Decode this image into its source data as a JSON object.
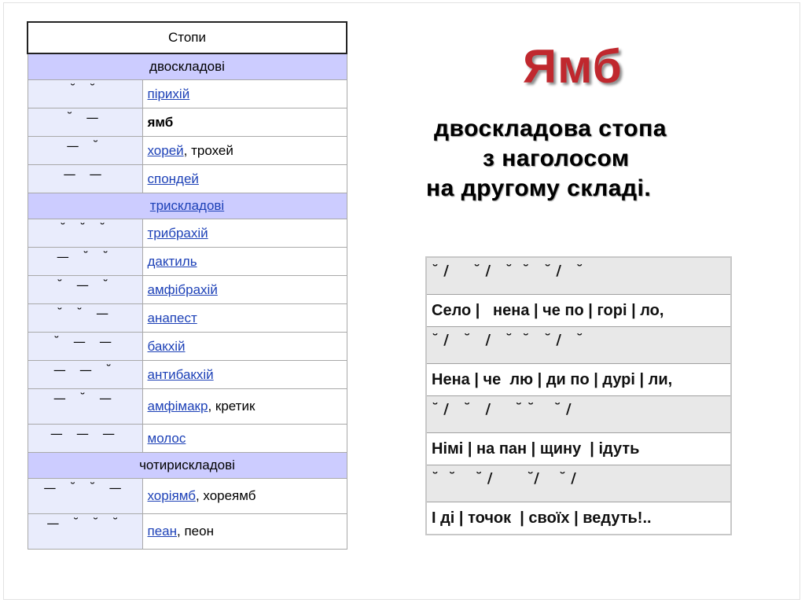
{
  "feet_table": {
    "header": "Стопи",
    "groups": {
      "two": "двоскладові",
      "three": "трискладові",
      "four": "чотирискладові"
    },
    "rows": [
      {
        "meter": "˘ ˘",
        "name": "пірихій",
        "suffix": ""
      },
      {
        "meter": "˘ —",
        "name": "ямб",
        "suffix": ""
      },
      {
        "meter": "— ˘",
        "name": "хорей",
        "suffix": ", трохей"
      },
      {
        "meter": "— —",
        "name": "спондей",
        "suffix": ""
      },
      {
        "meter": "˘ ˘ ˘",
        "name": "трибрахій",
        "suffix": ""
      },
      {
        "meter": "— ˘ ˘",
        "name": "дактиль",
        "suffix": ""
      },
      {
        "meter": "˘ — ˘",
        "name": "амфібрахій",
        "suffix": ""
      },
      {
        "meter": "˘ ˘ —",
        "name": "анапест",
        "suffix": ""
      },
      {
        "meter": "˘ — —",
        "name": "бакхій",
        "suffix": ""
      },
      {
        "meter": "— — ˘",
        "name": "антибакхій",
        "suffix": ""
      },
      {
        "meter": "— ˘ —",
        "name": "амфімакр",
        "suffix": ", кретик"
      },
      {
        "meter": "— — —",
        "name": "молос",
        "suffix": ""
      },
      {
        "meter": "— ˘ ˘ —",
        "name": "хоріямб",
        "suffix": ", хореямб"
      },
      {
        "meter": "— ˘ ˘ ˘",
        "name": "пеан",
        "suffix": ", пеон"
      }
    ]
  },
  "title": "Ямб",
  "definition": {
    "line1": "двоскладова стопа",
    "line2": "з наголосом",
    "line3": "на другому складі."
  },
  "poem": [
    "˘ /     ˘ /   ˘  ˘   ˘ /   ˘",
    "Село |   нена | че по | горі | ло,",
    "˘ /   ˘   /   ˘  ˘   ˘ /   ˘",
    "Нена | че  лю | ди по | дурі | ли,",
    "˘ /   ˘   /     ˘ ˘    ˘ /",
    "Німі | на пан | щину  | ідуть",
    "˘  ˘    ˘ /       ˘/    ˘ /",
    "І ді | точок  | своїх | ведуть!.."
  ]
}
